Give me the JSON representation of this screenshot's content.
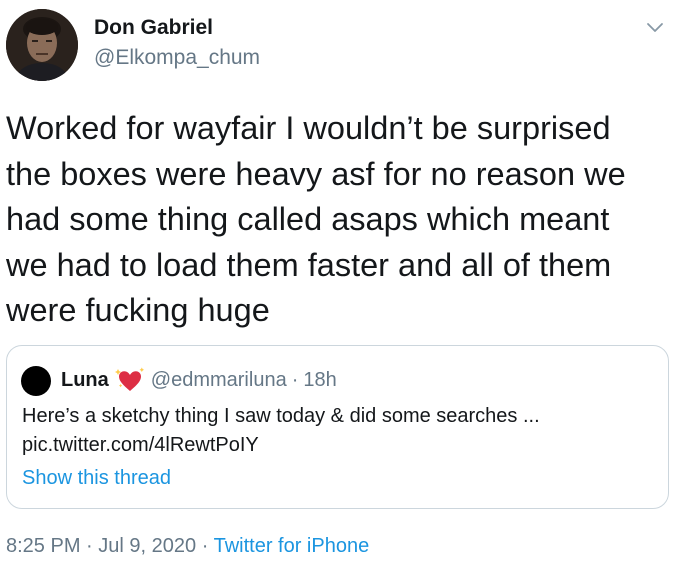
{
  "tweet": {
    "author": {
      "display_name": "Don Gabriel",
      "handle": "@Elkompa_chum",
      "avatar_icon": "user-photo"
    },
    "menu_icon": "chevron-down-icon",
    "text": "Worked for wayfair I wouldn’t be surprised\nthe boxes were heavy asf for no reason we\nhad some thing called asaps which meant\nwe had to load them faster and all of them\nwere fucking huge",
    "timestamp": {
      "time": "8:25 PM",
      "separator": "·",
      "date": "Jul 9, 2020",
      "source": "Twitter for iPhone"
    }
  },
  "quoted_tweet": {
    "display_name": "Luna",
    "emoji_icon": "sparkling-heart-icon",
    "handle": "@edmmariluna",
    "separator": "·",
    "time_ago": "18h",
    "text": "Here’s a sketchy thing I saw today & did some searches ...\npic.twitter.com/4lRewtPoIY",
    "show_thread_label": "Show this thread"
  },
  "colors": {
    "text_primary": "#14171a",
    "text_secondary": "#657786",
    "link": "#1b95e0",
    "border": "#ccd6dd"
  }
}
